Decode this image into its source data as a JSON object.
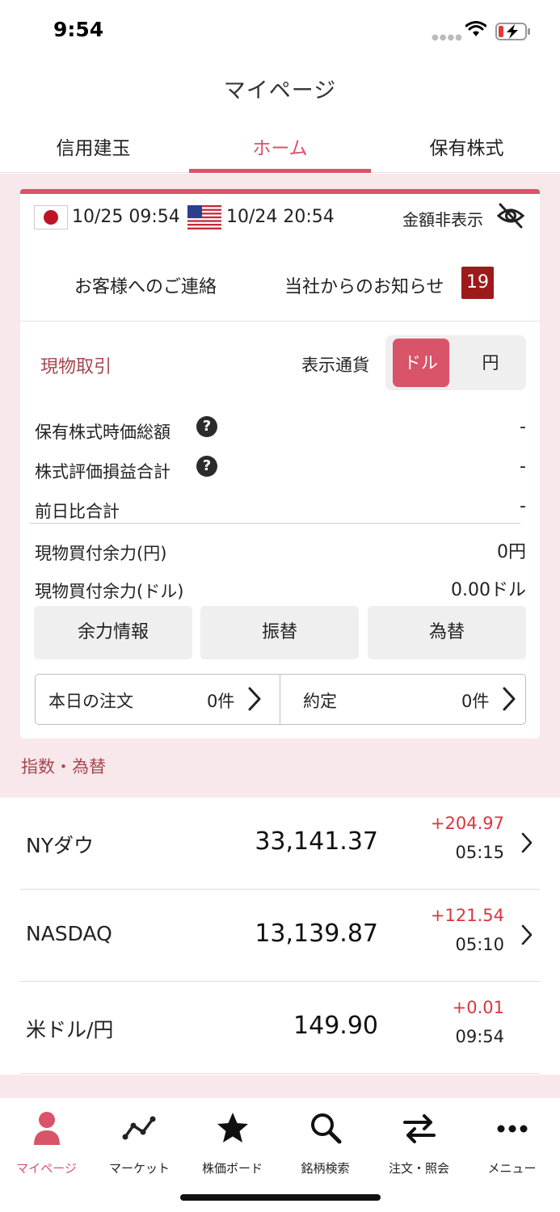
{
  "status_bar": {
    "time": "9:54"
  },
  "header": {
    "title": "マイページ"
  },
  "tabs": [
    {
      "label": "信用建玉",
      "active": false
    },
    {
      "label": "ホーム",
      "active": true
    },
    {
      "label": "保有株式",
      "active": false
    }
  ],
  "market_times": {
    "jp": {
      "flag": "jp-flag-icon",
      "time": "10/25 09:54"
    },
    "us": {
      "flag": "us-flag-icon",
      "time": "10/24 20:54"
    },
    "hide_amount_label": "金額非表示"
  },
  "notices": {
    "contact_label": "お客様へのご連絡",
    "news_label": "当社からのお知らせ",
    "news_count": "19"
  },
  "spot_trading": {
    "section_label": "現物取引",
    "currency_label": "表示通貨",
    "currency_options": [
      "ドル",
      "円"
    ],
    "selected_currency": "ドル",
    "rows": [
      {
        "label": "保有株式時価総額",
        "value": "-",
        "help": true
      },
      {
        "label": "株式評価損益合計",
        "value": "-",
        "help": true
      },
      {
        "label": "前日比合計",
        "value": "-",
        "help": false
      }
    ],
    "buying_power_yen": {
      "label": "現物買付余力(円)",
      "value": "0円"
    },
    "buying_power_usd": {
      "label": "現物買付余力(ドル)",
      "value": "0.00ドル"
    },
    "actions": [
      "余力情報",
      "振替",
      "為替"
    ],
    "orders": {
      "today_label": "本日の注文",
      "today_count": "0件",
      "executed_label": "約定",
      "executed_count": "0件"
    }
  },
  "indices": {
    "header": "指数・為替",
    "items": [
      {
        "name": "NYダウ",
        "price": "33,141.37",
        "change": "+204.97",
        "time": "05:15"
      },
      {
        "name": "NASDAQ",
        "price": "13,139.87",
        "change": "+121.54",
        "time": "05:10"
      },
      {
        "name": "米ドル/円",
        "price": "149.90",
        "change": "+0.01",
        "time": "09:54"
      }
    ]
  },
  "bottom_nav": [
    {
      "label": "マイページ",
      "icon": "person-icon",
      "active": true
    },
    {
      "label": "マーケット",
      "icon": "chart-line-icon",
      "active": false
    },
    {
      "label": "株価ボード",
      "icon": "star-icon",
      "active": false
    },
    {
      "label": "銘柄検索",
      "icon": "search-icon",
      "active": false
    },
    {
      "label": "注文・照会",
      "icon": "swap-arrows-icon",
      "active": false
    },
    {
      "label": "メニュー",
      "icon": "more-icon",
      "active": false
    }
  ],
  "colors": {
    "accent": "#d95369",
    "badge": "#9d1a1a",
    "positive_change": "#d9363e",
    "background_pink": "#f8e7eb"
  }
}
